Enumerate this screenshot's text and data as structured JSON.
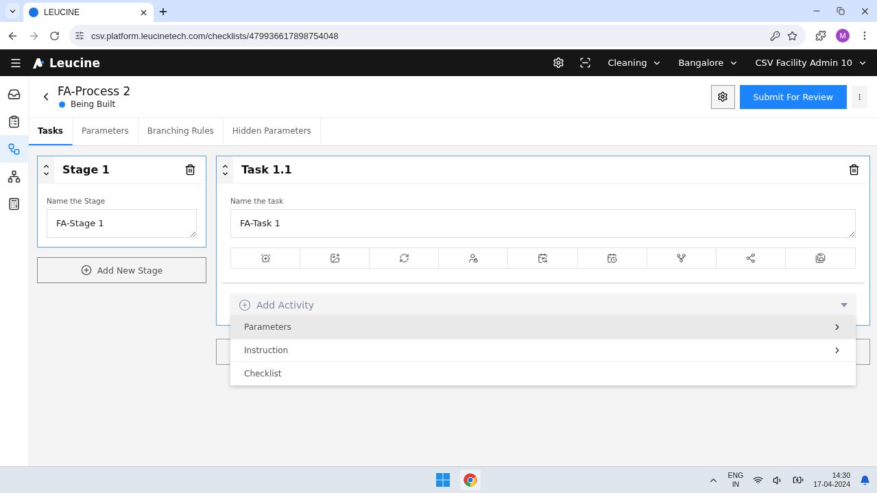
{
  "browser": {
    "tab_title": "LEUCINE",
    "url": "csv.platform.leucinetech.com/checklists/479936617898754048",
    "profile_initial": "M"
  },
  "header": {
    "brand": "Leucine",
    "menus": [
      "Cleaning",
      "Bangalore",
      "CSV Facility Admin 10"
    ]
  },
  "sidebar": {
    "items": [
      {
        "selected": false
      },
      {
        "selected": false
      },
      {
        "selected": true
      },
      {
        "selected": false
      },
      {
        "selected": false
      }
    ]
  },
  "page": {
    "title": "FA-Process 2",
    "status": "Being Built",
    "submit_label": "Submit For Review"
  },
  "tabs": [
    {
      "label": "Tasks",
      "selected": true
    },
    {
      "label": "Parameters",
      "selected": false
    },
    {
      "label": "Branching Rules",
      "selected": false
    },
    {
      "label": "Hidden Parameters",
      "selected": false
    }
  ],
  "stage": {
    "title": "Stage 1",
    "field_label": "Name the Stage",
    "value": "FA-Stage 1",
    "selected": true
  },
  "add_stage_label": "Add New Stage",
  "task": {
    "title": "Task 1.1",
    "field_label": "Name the task",
    "value": "FA-Task 1",
    "selected": true
  },
  "add_activity": {
    "label": "Add Activity",
    "expanded": true,
    "options": [
      {
        "label": "Parameters",
        "has_submenu": true,
        "selected": true
      },
      {
        "label": "Instruction",
        "has_submenu": true,
        "selected": false
      },
      {
        "label": "Checklist",
        "has_submenu": false,
        "selected": false
      }
    ]
  },
  "taskbar": {
    "language": "ENG",
    "region": "IN",
    "time": "14:30",
    "date": "17-04-2024"
  }
}
